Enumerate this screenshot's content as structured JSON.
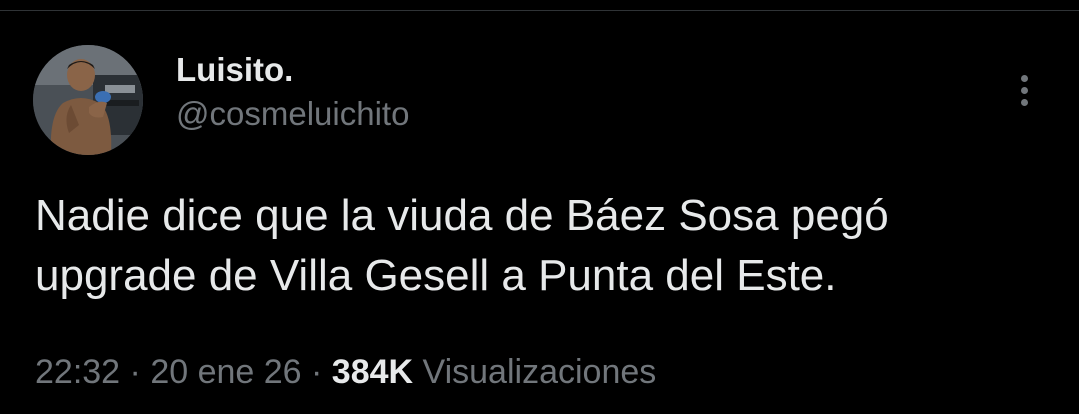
{
  "tweet": {
    "author": {
      "display_name": "Luisito.",
      "handle": "@cosmeluichito"
    },
    "text": "Nadie dice que la viuda de Báez Sosa pegó\nupgrade de Villa Gesell a Punta del Este.",
    "time": "22:32",
    "date": "20 ene 26",
    "separator": " · ",
    "views_count": "384K",
    "views_label": "Visualizaciones"
  },
  "icons": {
    "more": "more-options-icon",
    "avatar": "profile-avatar"
  },
  "colors": {
    "background": "#000000",
    "primary_text": "#e7e9ea",
    "secondary_text": "#71767b",
    "divider": "#2f3336"
  }
}
